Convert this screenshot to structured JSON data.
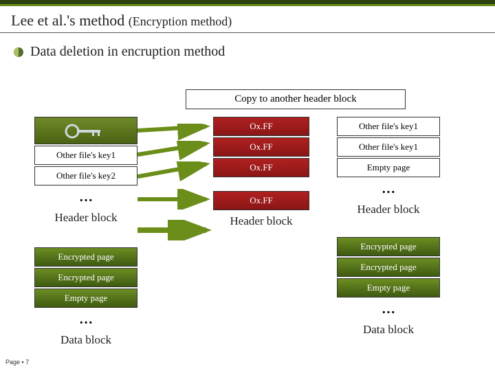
{
  "title_main": "Lee et al.'s method",
  "title_sub": "(Encryption method)",
  "bullet_text": "Data deletion in encruption method",
  "copy_box": "Copy to another header block",
  "col1": {
    "key_icon": "key-icon",
    "items": [
      "Other file's key1",
      "Other file's key2"
    ],
    "dots": "…",
    "label": "Header block"
  },
  "col2a": {
    "items": [
      "Ox.FF",
      "Ox.FF",
      "Ox.FF"
    ],
    "dots_item": "Ox.FF",
    "label": "Header block"
  },
  "col2b": {
    "items": [
      "Other file's key1",
      "Other file's key1",
      "Empty page"
    ],
    "dots": "…",
    "label": "Header block"
  },
  "col1b": {
    "items": [
      "Encrypted page",
      "Encrypted page",
      "Empty page"
    ],
    "dots": "…",
    "label": "Data block"
  },
  "col3": {
    "items": [
      "Encrypted page",
      "Encrypted page",
      "Empty page"
    ],
    "dots": "…",
    "label": "Data block"
  },
  "page_label": "Page ▪ 7"
}
